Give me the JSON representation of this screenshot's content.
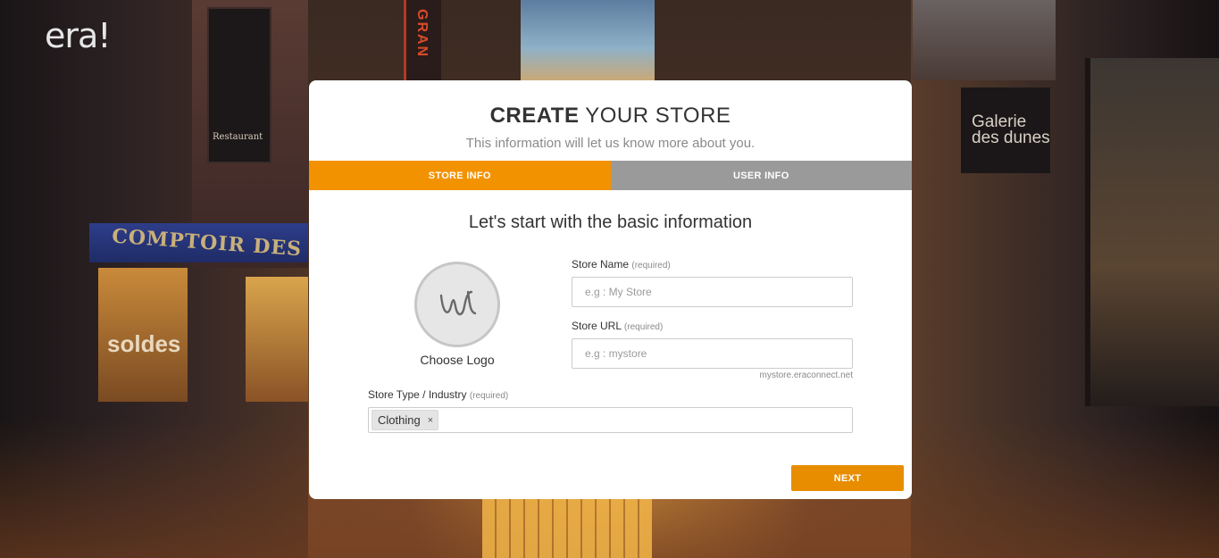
{
  "brand": {
    "logo_text": "era!"
  },
  "card": {
    "title_bold": "CREATE",
    "title_rest": " YOUR STORE",
    "subtitle": "This information will let us know more about you."
  },
  "tabs": [
    {
      "label": "STORE INFO",
      "active": true
    },
    {
      "label": "USER INFO",
      "active": false
    }
  ],
  "form": {
    "heading": "Let's start with the basic information",
    "choose_logo_label": "Choose Logo",
    "required_marker": "(required)",
    "store_name": {
      "label": "Store Name",
      "placeholder": "e.g : My Store",
      "value": ""
    },
    "store_url": {
      "label": "Store URL",
      "placeholder": "e.g : mystore",
      "value": "",
      "hint": "mystore.eraconnect.net"
    },
    "store_type": {
      "label": "Store Type / Industry",
      "tags": [
        "Clothing"
      ],
      "remove_glyph": "×"
    },
    "next_label": "NEXT"
  },
  "background": {
    "awning_text": "COMPTOIR DES ISSES",
    "shop_sign": "soldes",
    "restaurant_sign": "Restaurant",
    "gran_sign": "GRAN",
    "galerie_sign": "Galerie des dunes"
  },
  "colors": {
    "accent": "#f39200",
    "button": "#e88d00",
    "tab_inactive": "#9a9a9a"
  },
  "icons": {
    "logo_placeholder": "squiggle-w-icon",
    "tag_remove": "close-icon"
  }
}
